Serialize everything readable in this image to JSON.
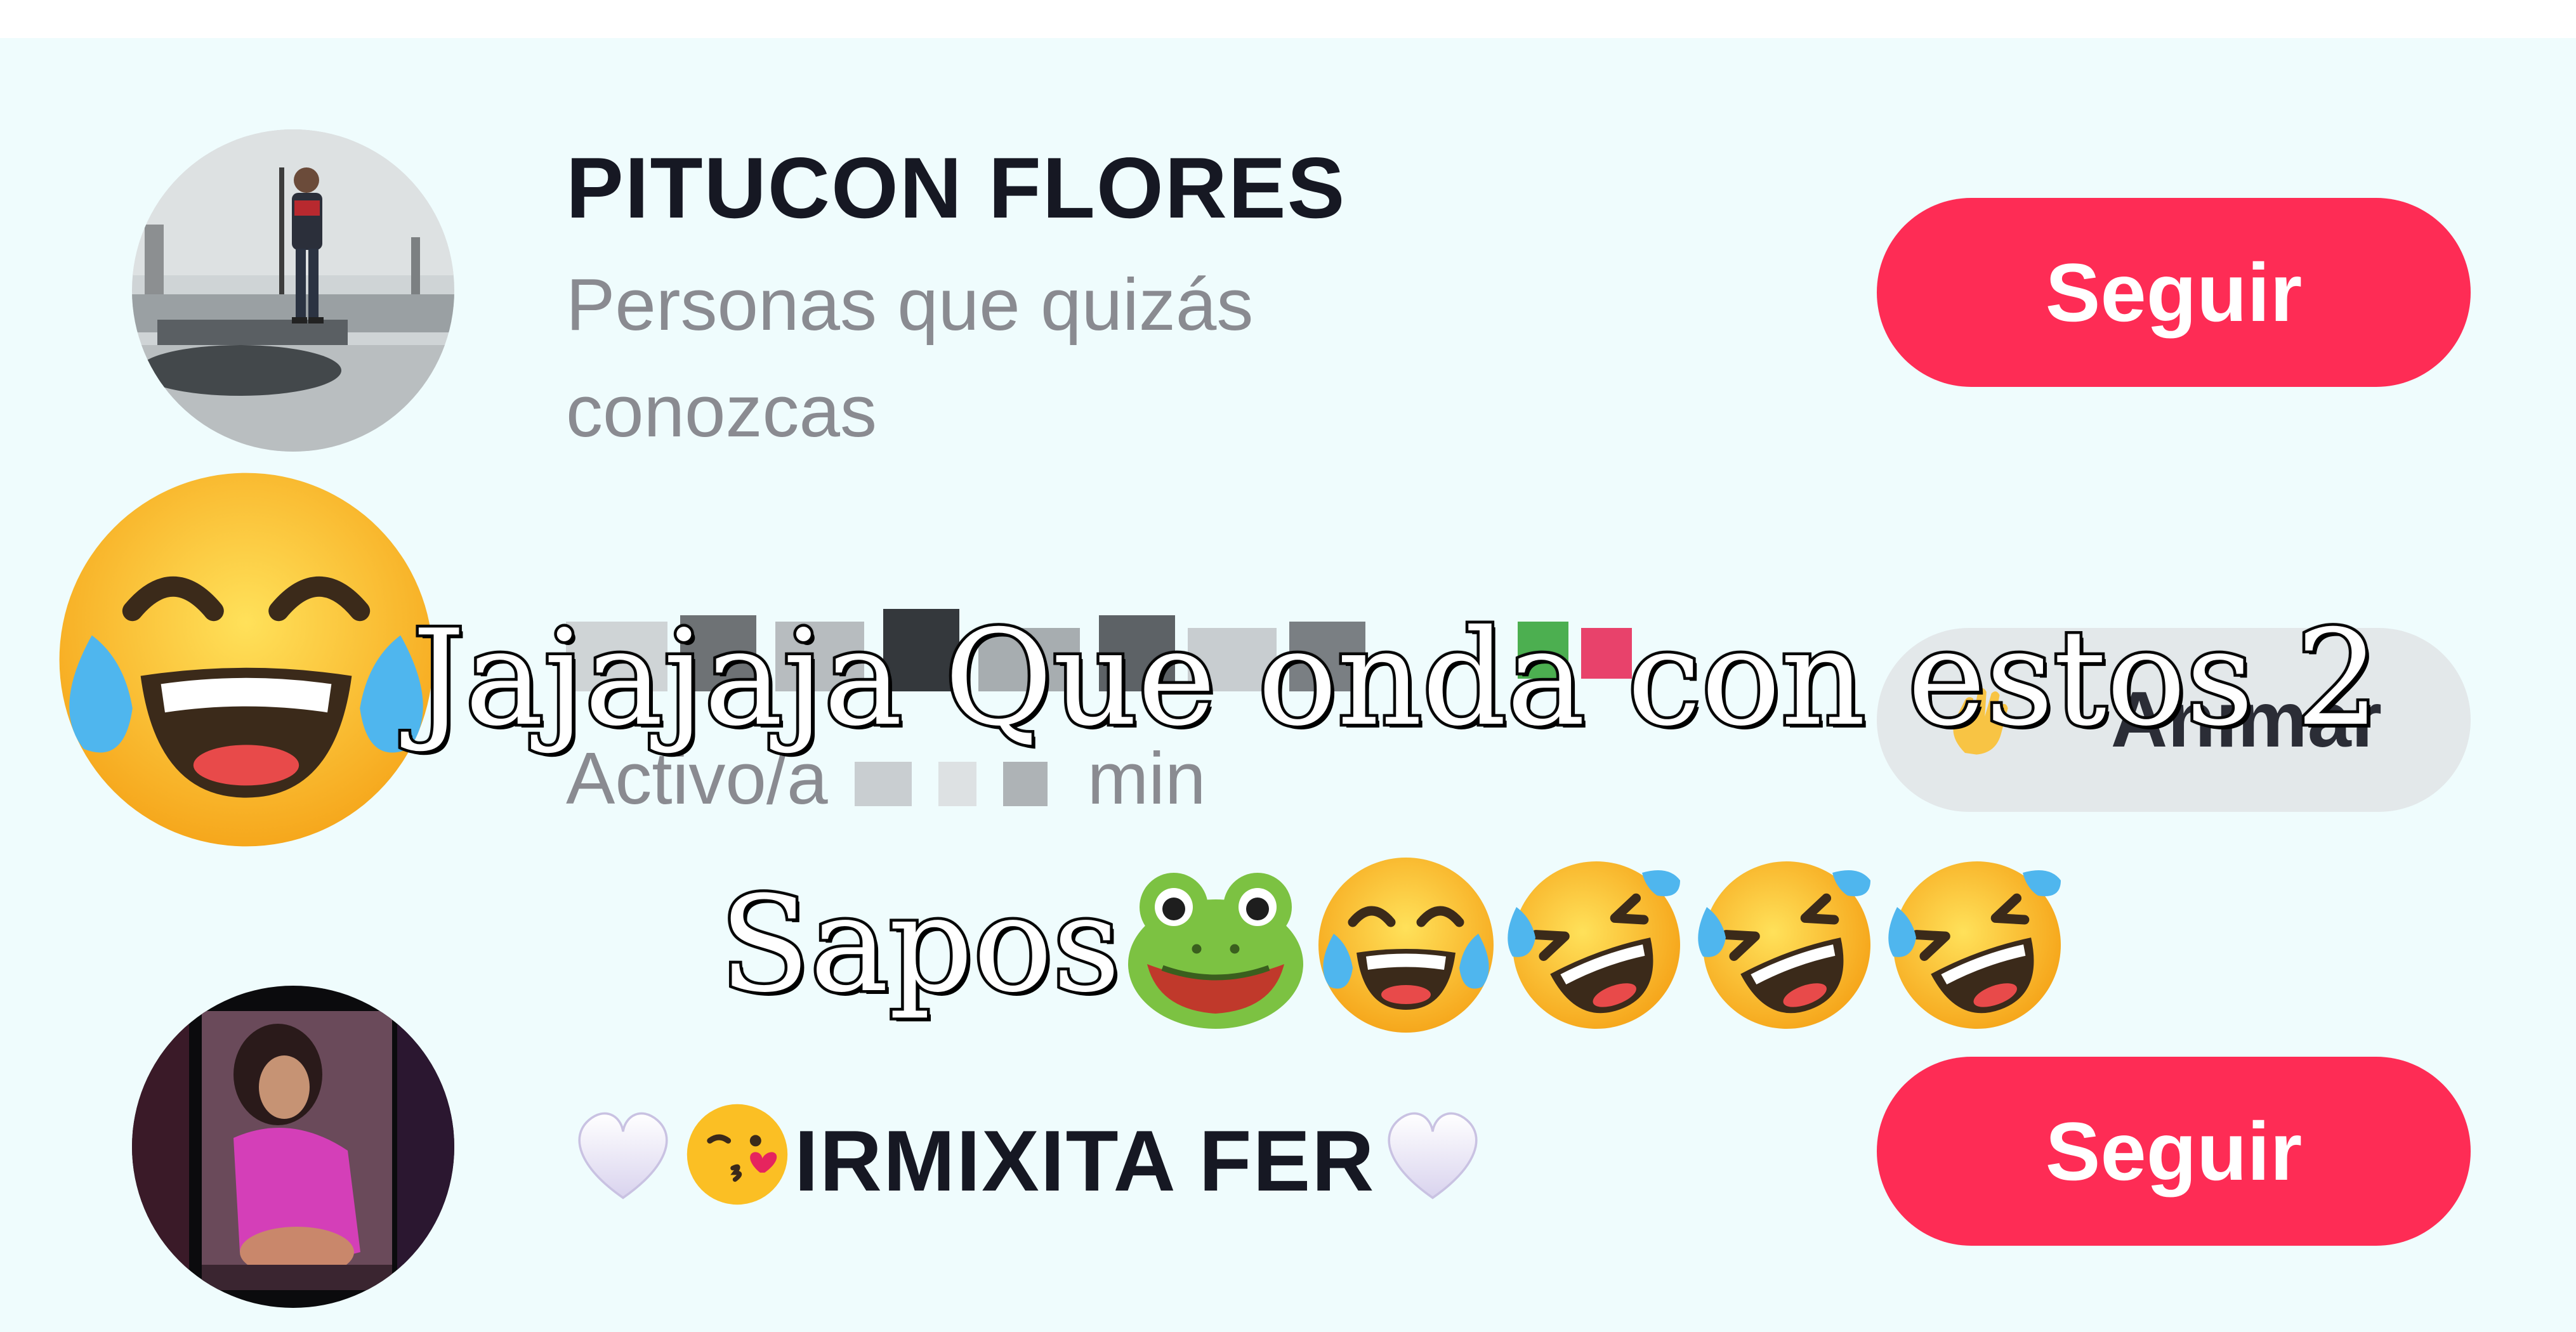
{
  "suggestions": [
    {
      "name": "PITUCON FLORES",
      "subtitle": "Personas que quizás conozcas",
      "action_label": "Seguir"
    },
    {
      "name": "",
      "status_prefix": "Activo/a",
      "status_suffix": "min",
      "action_label": "Animar",
      "action_icon": "waving-hand-emoji"
    },
    {
      "name": "IRMIXITA FER",
      "name_prefix_icons": [
        "white-heart-emoji",
        "kissing-face-emoji"
      ],
      "name_suffix_icons": [
        "white-heart-emoji"
      ],
      "action_label": "Seguir"
    }
  ],
  "overlay": {
    "caption_line1": "Jajajaja Que onda con estos 2",
    "caption_line2": "Sapos",
    "caption_emojis": [
      "frog-emoji",
      "tears-of-joy-emoji",
      "rofl-emoji",
      "rofl-emoji",
      "rofl-emoji"
    ],
    "sticker": "tears-of-joy-emoji"
  },
  "colors": {
    "follow_button": "#fe2c55",
    "panel_background": "#effcfd",
    "secondary_text": "#8a8b91",
    "animate_button": "#e3e8ea"
  }
}
